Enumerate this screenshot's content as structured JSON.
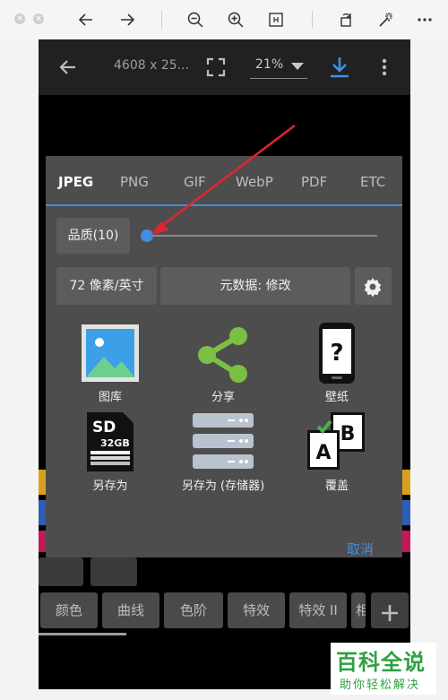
{
  "viewer_toolbar": {
    "icons": [
      "close-icon",
      "minimize-icon",
      "back-arrow-icon",
      "forward-arrow-icon",
      "zoom-out-icon",
      "zoom-in-icon",
      "fit-icon",
      "rotate-icon",
      "magic-wand-icon",
      "more-icon"
    ]
  },
  "app_bar": {
    "dimensions": "4608 x 25...",
    "zoom": "21%"
  },
  "dialog": {
    "tabs": [
      {
        "label": "JPEG",
        "active": true
      },
      {
        "label": "PNG"
      },
      {
        "label": "GIF"
      },
      {
        "label": "WebP"
      },
      {
        "label": "PDF"
      },
      {
        "label": "ETC"
      }
    ],
    "quality_label": "品质(10)",
    "quality_value": 10,
    "dpi_label": "72 像素/英寸",
    "metadata_label": "元数据: 修改",
    "actions": [
      {
        "label": "图库",
        "icon": "gallery-icon"
      },
      {
        "label": "分享",
        "icon": "share-icon"
      },
      {
        "label": "壁纸",
        "icon": "wallpaper-phone-icon"
      },
      {
        "label": "另存为",
        "icon": "sd-card-icon",
        "sd_text": "SD",
        "sd_size": "32GB"
      },
      {
        "label": "另存为 (存储器)",
        "icon": "storage-icon"
      },
      {
        "label": "覆盖",
        "icon": "overwrite-icon",
        "front_letter": "A",
        "back_letter": "B"
      }
    ],
    "cancel_label": "取消"
  },
  "bottom_bar": {
    "buttons": [
      "颜色",
      "曲线",
      "色阶",
      "特效",
      "特效 II",
      "相"
    ]
  },
  "watermark": {
    "main": "百科全说",
    "sub": "助你轻松解决"
  },
  "colors": {
    "accent_blue": "#3f8fe0",
    "annotation_red": "#e0252f",
    "share_green": "#7bc043",
    "watermark_green": "#2ea141"
  }
}
